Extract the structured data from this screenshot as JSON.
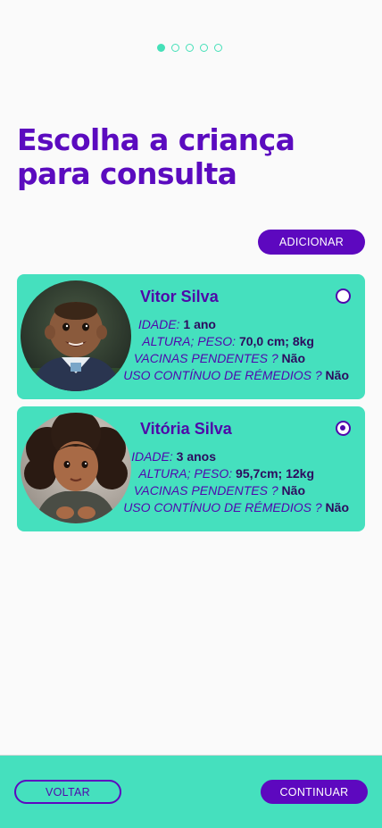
{
  "stepper": {
    "total_steps": 5,
    "current_step": 1
  },
  "page_title": "Escolha a criança para consulta",
  "actions": {
    "add_label": "ADICIONAR",
    "back_label": "VOLTAR",
    "continue_label": "CONTINUAR"
  },
  "labels": {
    "age": "IDADE:",
    "height_weight": "ALTURA; PESO:",
    "pending_vaccines": "VACINAS PENDENTES ?",
    "continuous_medicine": "USO CONTÍNUO DE RÉMEDIOS ?"
  },
  "children": [
    {
      "name": "Vitor Silva",
      "age": "1 ano",
      "height_weight": "70,0 cm; 8kg",
      "pending_vaccines": "Não",
      "continuous_medicine": "Não",
      "selected": false
    },
    {
      "name": "Vitória Silva",
      "age": "3 anos",
      "height_weight": "95,7cm; 12kg",
      "pending_vaccines": "Não",
      "continuous_medicine": "Não",
      "selected": true
    }
  ],
  "colors": {
    "primary": "#5d08bf",
    "accent": "#45e0be",
    "background": "#fafafa"
  }
}
